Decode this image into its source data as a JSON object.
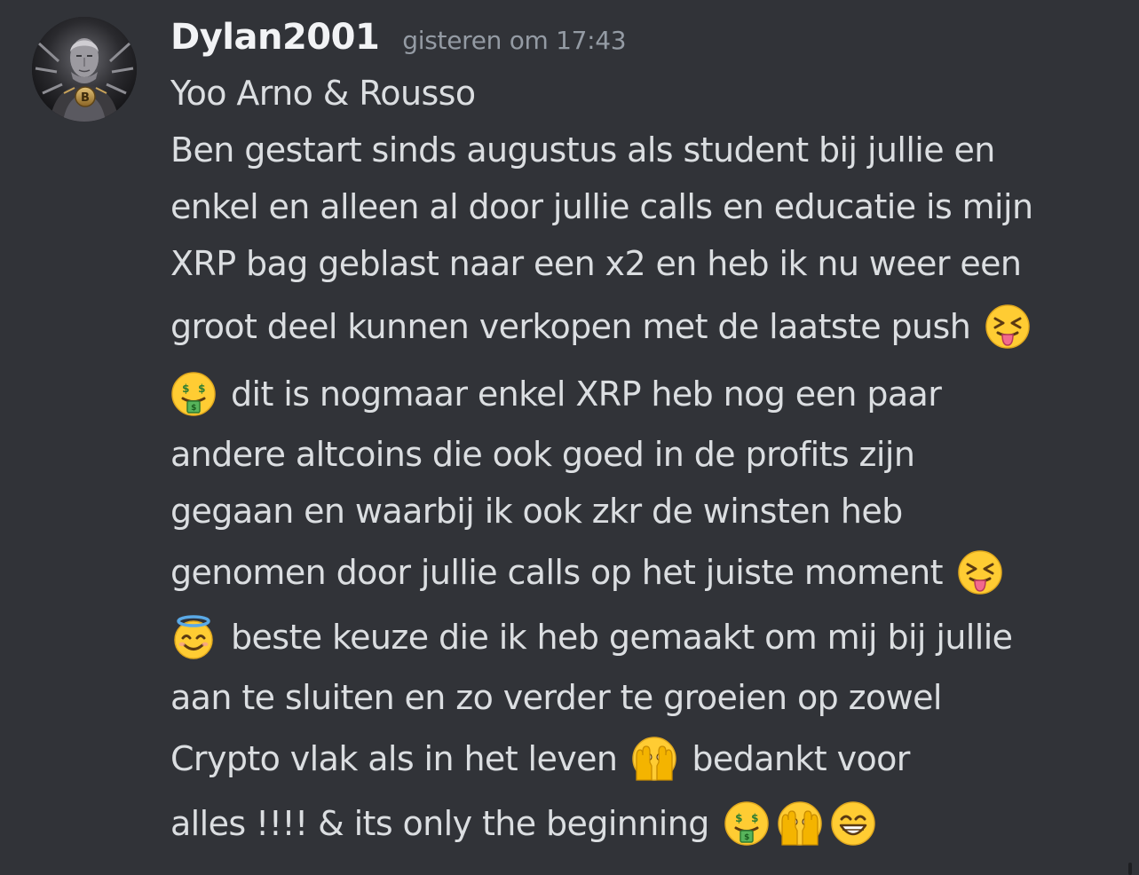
{
  "message": {
    "author": "Dylan2001",
    "timestamp": "gisteren om 17:43",
    "avatar_icon": "bitcoin-figure-avatar",
    "lines": [
      "Yoo Arno & Rousso",
      "Ben gestart sinds augustus als student bij jullie en",
      "enkel en alleen al door jullie calls en educatie is mijn",
      "XRP bag geblast naar een x2 en heb ik nu weer een",
      "groot deel kunnen verkopen met de laatste push",
      "dit is nogmaar enkel XRP heb nog een paar",
      "andere altcoins die ook goed in de profits zijn",
      "gegaan en waarbij ik ook zkr de winsten heb",
      "genomen door jullie calls op het juiste moment",
      "beste keuze die ik heb gemaakt om mij bij jullie",
      "aan te sluiten en zo verder te groeien op zowel",
      "Crypto vlak als in het leven",
      "bedankt voor",
      "alles !!!! & its only the beginning"
    ],
    "emojis": {
      "squint_tongue": "squinting-face-with-tongue-icon",
      "money_mouth": "money-mouth-face-icon",
      "halo": "smiling-face-with-halo-icon",
      "peek": "face-with-peeking-eye-icon",
      "grin": "beaming-face-icon"
    }
  },
  "colors": {
    "background": "#313338",
    "username": "#f2f3f5",
    "timestamp": "#949ba4",
    "text": "#dbdee1"
  }
}
